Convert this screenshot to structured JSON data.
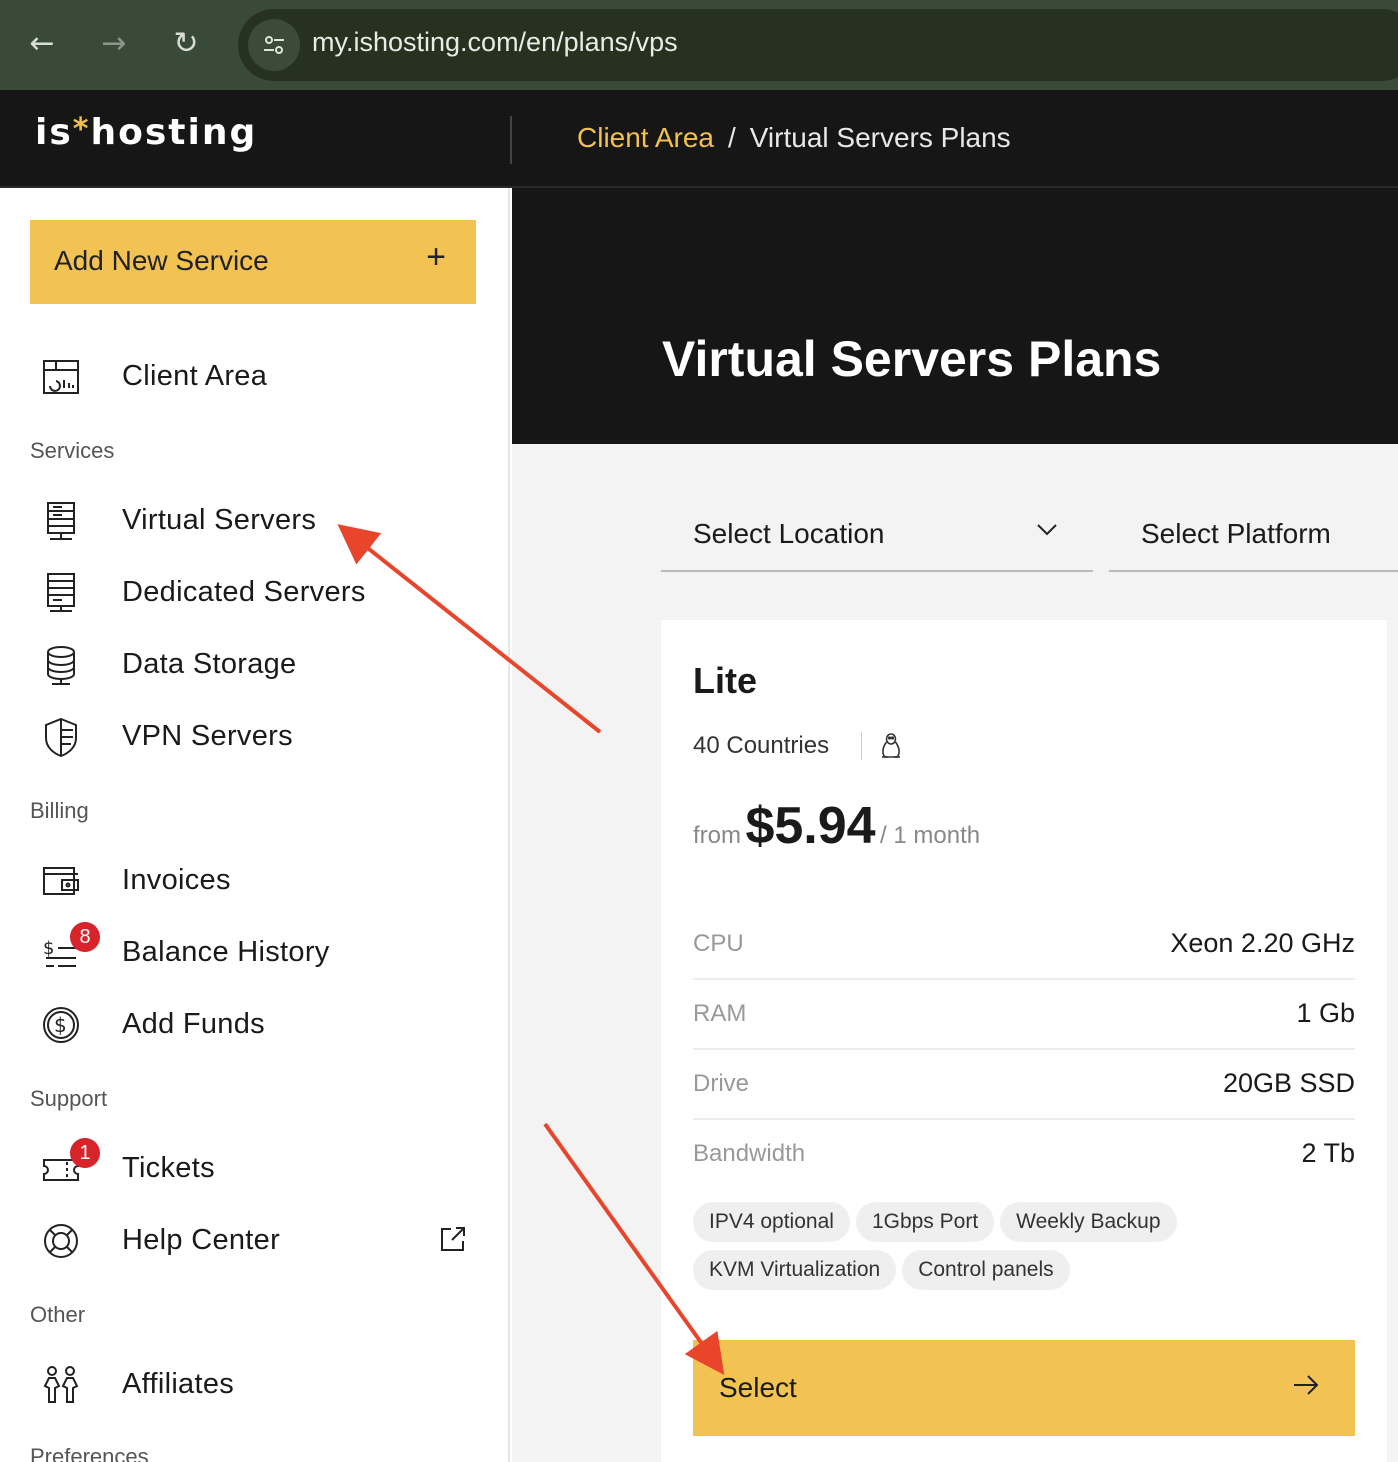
{
  "browser": {
    "url": "my.ishosting.com/en/plans/vps",
    "back_icon": "arrow-left-icon",
    "forward_icon": "arrow-right-icon",
    "reload_icon": "reload-icon"
  },
  "header": {
    "logo_left": "is",
    "logo_star": "*",
    "logo_right": "hosting",
    "breadcrumb": {
      "link": "Client Area",
      "separator": "/",
      "current": "Virtual Servers Plans"
    }
  },
  "sidebar": {
    "add_button": {
      "label": "Add New Service",
      "icon": "+"
    },
    "top_items": [
      {
        "label": "Client Area",
        "icon": "dashboard-icon"
      }
    ],
    "sections": [
      {
        "title": "Services",
        "items": [
          {
            "label": "Virtual Servers",
            "icon": "server-icon"
          },
          {
            "label": "Dedicated Servers",
            "icon": "server-rack-icon"
          },
          {
            "label": "Data Storage",
            "icon": "database-icon"
          },
          {
            "label": "VPN Servers",
            "icon": "shield-icon"
          }
        ]
      },
      {
        "title": "Billing",
        "items": [
          {
            "label": "Invoices",
            "icon": "wallet-icon"
          },
          {
            "label": "Balance History",
            "icon": "balance-list-icon",
            "badge": "8"
          },
          {
            "label": "Add Funds",
            "icon": "dollar-circle-icon"
          }
        ]
      },
      {
        "title": "Support",
        "items": [
          {
            "label": "Tickets",
            "icon": "ticket-icon",
            "badge": "1"
          },
          {
            "label": "Help Center",
            "icon": "lifebuoy-icon",
            "external_icon": "external-link-icon"
          }
        ]
      },
      {
        "title": "Other",
        "items": [
          {
            "label": "Affiliates",
            "icon": "people-icon"
          }
        ]
      },
      {
        "title": "Preferences",
        "items": []
      }
    ]
  },
  "main": {
    "title": "Virtual Servers Plans",
    "filters": {
      "location": "Select Location",
      "platform": "Select Platform"
    },
    "plan": {
      "name": "Lite",
      "countries": "40 Countries",
      "os_icon": "linux-icon",
      "price_prefix": "from",
      "price": "$5.94",
      "period": "/ 1 month",
      "specs": [
        {
          "key": "CPU",
          "value": "Xeon 2.20 GHz"
        },
        {
          "key": "RAM",
          "value": "1 Gb"
        },
        {
          "key": "Drive",
          "value": "20GB SSD"
        },
        {
          "key": "Bandwidth",
          "value": "2 Tb"
        }
      ],
      "features": [
        "IPV4 optional",
        "1Gbps Port",
        "Weekly Backup",
        "KVM Virtualization",
        "Control panels"
      ],
      "select_label": "Select",
      "select_icon": "arrow-right-icon"
    }
  },
  "annotations": {
    "arrow_color": "#e8452c"
  },
  "colors": {
    "accent": "#f2c353",
    "link": "#f2c14e",
    "badge": "#d8232a",
    "dark": "#161616"
  }
}
